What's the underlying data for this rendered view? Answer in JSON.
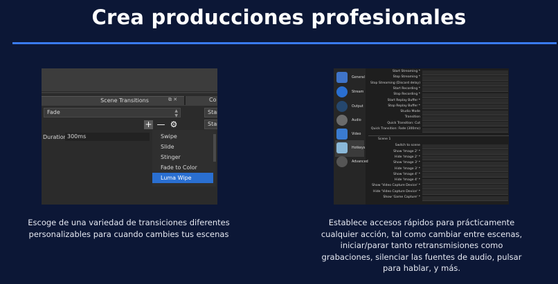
{
  "heading": "Crea producciones profesionales",
  "colors": {
    "background": "#0c1736",
    "accent_rule": "#3a7bf0",
    "selection": "#2a6fd1"
  },
  "left_card": {
    "caption_lines": [
      "Escoge de una variedad de transiciones diferentes",
      "personalizables para cuando cambies tus escenas"
    ],
    "panel": {
      "dock_title": "Scene Transitions",
      "dock_icons": "⧉ ✕",
      "second_dock_title": "Co",
      "transition_select_value": "Fade",
      "start_buttons": [
        "Star",
        "Star"
      ],
      "tool_icons": {
        "add": "+",
        "remove": "—",
        "settings": "⚙"
      },
      "duration_label": "Duration",
      "duration_value": "300ms",
      "menu_items": [
        "Swipe",
        "Slide",
        "Stinger",
        "Fade to Color",
        "Luma Wipe"
      ],
      "selected_menu_item": "Luma Wipe"
    }
  },
  "right_card": {
    "caption_lines": [
      "Establece accesos rápidos para prácticamente",
      "cualquier acción, tal como cambiar entre escenas,",
      "iniciar/parar tanto retransmisiones como",
      "grabaciones, silenciar las fuentes de audio, pulsar",
      "para hablar, y más."
    ],
    "panel": {
      "nav_items": [
        {
          "label": "General",
          "icon": "general-icon",
          "color": "#3f74c9"
        },
        {
          "label": "Stream",
          "icon": "globe-icon",
          "color": "#2a6fd1"
        },
        {
          "label": "Output",
          "icon": "output-icon",
          "color": "#25476e"
        },
        {
          "label": "Audio",
          "icon": "speaker-icon",
          "color": "#6b6b6b"
        },
        {
          "label": "Video",
          "icon": "monitor-icon",
          "color": "#3a7bd0"
        },
        {
          "label": "Hotkeys",
          "icon": "keyboard-icon",
          "color": "#8ab8d8"
        },
        {
          "label": "Advanced",
          "icon": "gears-icon",
          "color": "#555555"
        }
      ],
      "active_nav": "Hotkeys",
      "hotkeys_top": [
        "Start Streaming *",
        "Stop Streaming *",
        "Stop Streaming (Discard delay)",
        "Start Recording *",
        "Stop Recording *",
        "Start Replay Buffer *",
        "Stop Replay Buffer *",
        "Studio Mode",
        "Transition",
        "Quick Transition: Cut",
        "Quick Transition: Fade (300ms)"
      ],
      "scene_label": "Scene 1",
      "hotkeys_scene": [
        "Switch to scene",
        "Show 'Image 2' *",
        "Hide 'Image 2' *",
        "Show 'Image 3' *",
        "Hide 'Image 3' *",
        "Show 'Image 4' *",
        "Hide 'Image 4' *",
        "Show 'Video Capture Device' *",
        "Hide 'Video Capture Device' *",
        "Show 'Game Capture' *"
      ]
    }
  }
}
